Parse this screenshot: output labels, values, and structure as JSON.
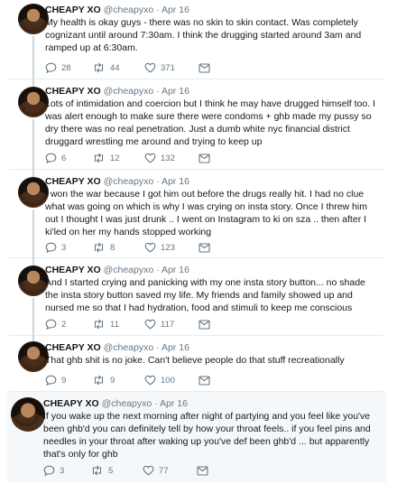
{
  "author": {
    "name": "CHEAPY XO",
    "handle": "@cheapyxo",
    "separator": "·"
  },
  "colors": {
    "text": "#14171a",
    "muted": "#657786",
    "divider": "#e6ecf0",
    "thread_line": "#ccd6dd",
    "highlight_bg": "#f5f8fa"
  },
  "icons": {
    "reply": "reply-icon",
    "retweet": "retweet-icon",
    "like": "heart-icon",
    "message": "message-icon"
  },
  "tweets": [
    {
      "date": "Apr 16",
      "text": "My health is okay guys - there was no skin to skin contact. Was completely cognizant until around 7:30am. I think the drugging started around 3am and ramped up at 6:30am.",
      "replies": "28",
      "retweets": "44",
      "likes": "371"
    },
    {
      "date": "Apr 16",
      "text": "Lots of intimidation and coercion but I think he may have drugged himself too. I was alert enough to make sure there were condoms + ghb made my pussy so dry there was no real penetration. Just a dumb white nyc financial district druggard wrestling me around and trying to keep up",
      "replies": "6",
      "retweets": "12",
      "likes": "132"
    },
    {
      "date": "Apr 16",
      "text": "I won the war because I got him out before the drugs really hit. I had no clue what was going on which is why I was crying on insta story. Once I threw him out I thought I was just drunk .. I went on Instagram to ki on sza .. then after I ki'led on her my hands stopped working",
      "replies": "3",
      "retweets": "8",
      "likes": "123"
    },
    {
      "date": "Apr 16",
      "text": "And I started crying and panicking with my one insta story button... no shade the insta story button saved my life. My friends and family showed up and nursed me so that I had hydration, food and stimuli to keep me conscious",
      "replies": "2",
      "retweets": "11",
      "likes": "117"
    },
    {
      "date": "Apr 16",
      "text": "That ghb shit is no joke. Can't believe people do that stuff recreationally",
      "replies": "9",
      "retweets": "9",
      "likes": "100"
    },
    {
      "date": "Apr 16",
      "text": "If you wake up the next morning after night of partying and you feel like you've been ghb'd you can definitely tell by how your throat feels.. if you feel pins and needles in your throat after waking up you've def been ghb'd ... but apparently that's only for ghb",
      "replies": "3",
      "retweets": "5",
      "likes": "77"
    }
  ]
}
